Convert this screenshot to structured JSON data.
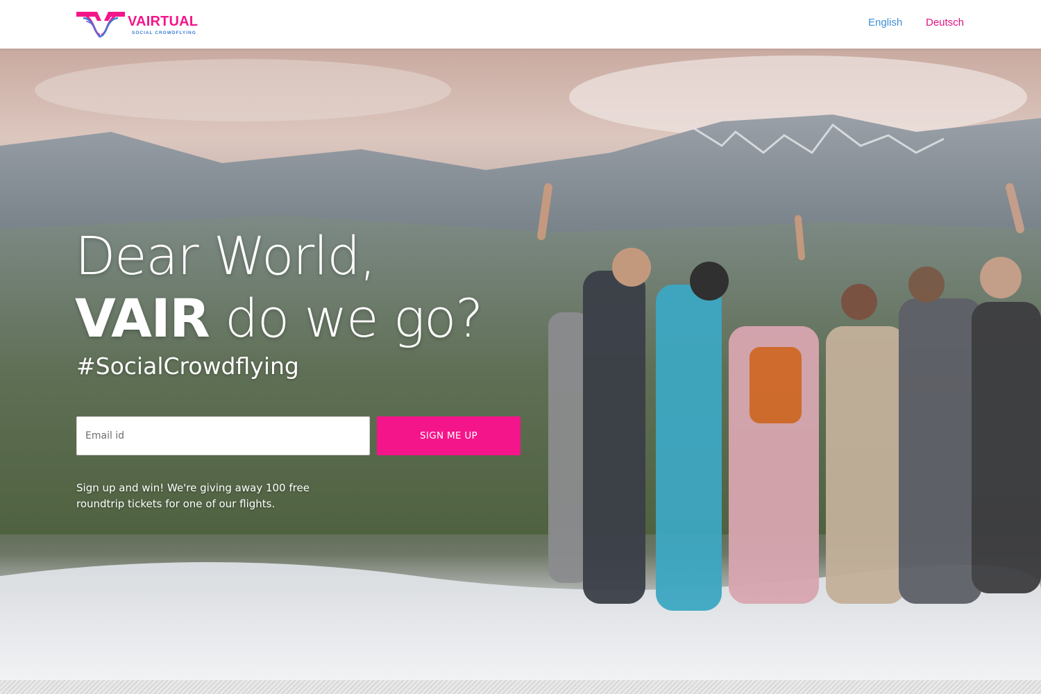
{
  "header": {
    "brand": {
      "name": "VAIRTUAL",
      "tagline": "SOCIAL CROWDFLYING",
      "primary_color": "#f5158a",
      "secondary_color": "#3b7bd8",
      "logo_icon": "winged-v-logo-icon"
    },
    "languages": [
      {
        "label": "English",
        "color": "#3e8fd6"
      },
      {
        "label": "Deutsch",
        "color": "#e01283"
      }
    ]
  },
  "hero": {
    "headline_line1": "Dear World,",
    "headline_strong": "VAIR",
    "headline_rest": "do we go?",
    "hashtag": "#SocialCrowdflying",
    "form": {
      "email_placeholder": "Email id",
      "email_value": "",
      "submit_label": "SIGN ME UP",
      "submit_color": "#f5158a"
    },
    "promo_text": "Sign up and win! We're giving away 100 free roundtrip tickets for one of our flights."
  }
}
